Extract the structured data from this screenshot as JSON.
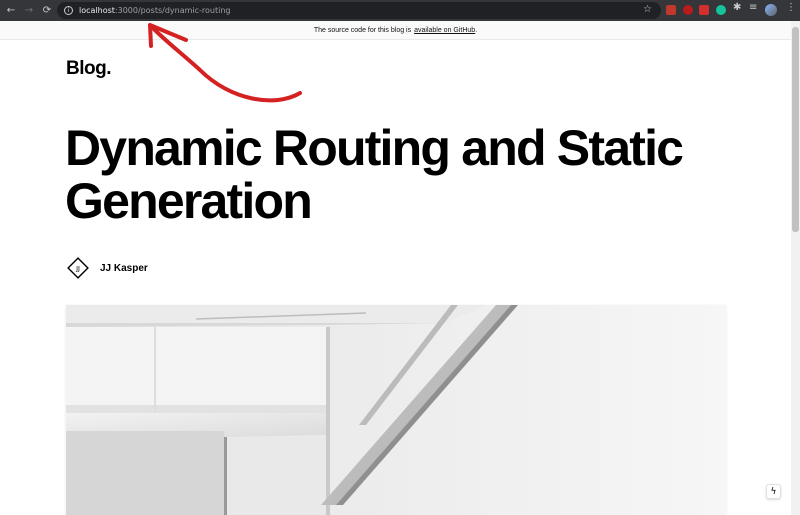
{
  "browser": {
    "url_host": "localhost",
    "url_rest": ":3000/posts/dynamic-routing",
    "back_icon": "←",
    "forward_icon": "→",
    "reload_icon": "⟳",
    "info_icon": "i",
    "star_icon": "☆",
    "extensions_icon": "✱",
    "media_icon": "≡",
    "menu_icon": "⋮"
  },
  "banner": {
    "text": "The source code for this blog is",
    "link_text": "available on GitHub",
    "suffix": "."
  },
  "header": {
    "logo": "Blog."
  },
  "post": {
    "title_line1": "Dynamic Routing and Static",
    "title_line2": "Generation",
    "author_name": "JJ Kasper",
    "avatar_initials": "JJ"
  },
  "colors": {
    "annotation_arrow": "#d42222",
    "chrome_bg": "#35363a",
    "omnibox_bg": "#202124"
  },
  "floating": {
    "bolt_icon": "ϟ"
  }
}
